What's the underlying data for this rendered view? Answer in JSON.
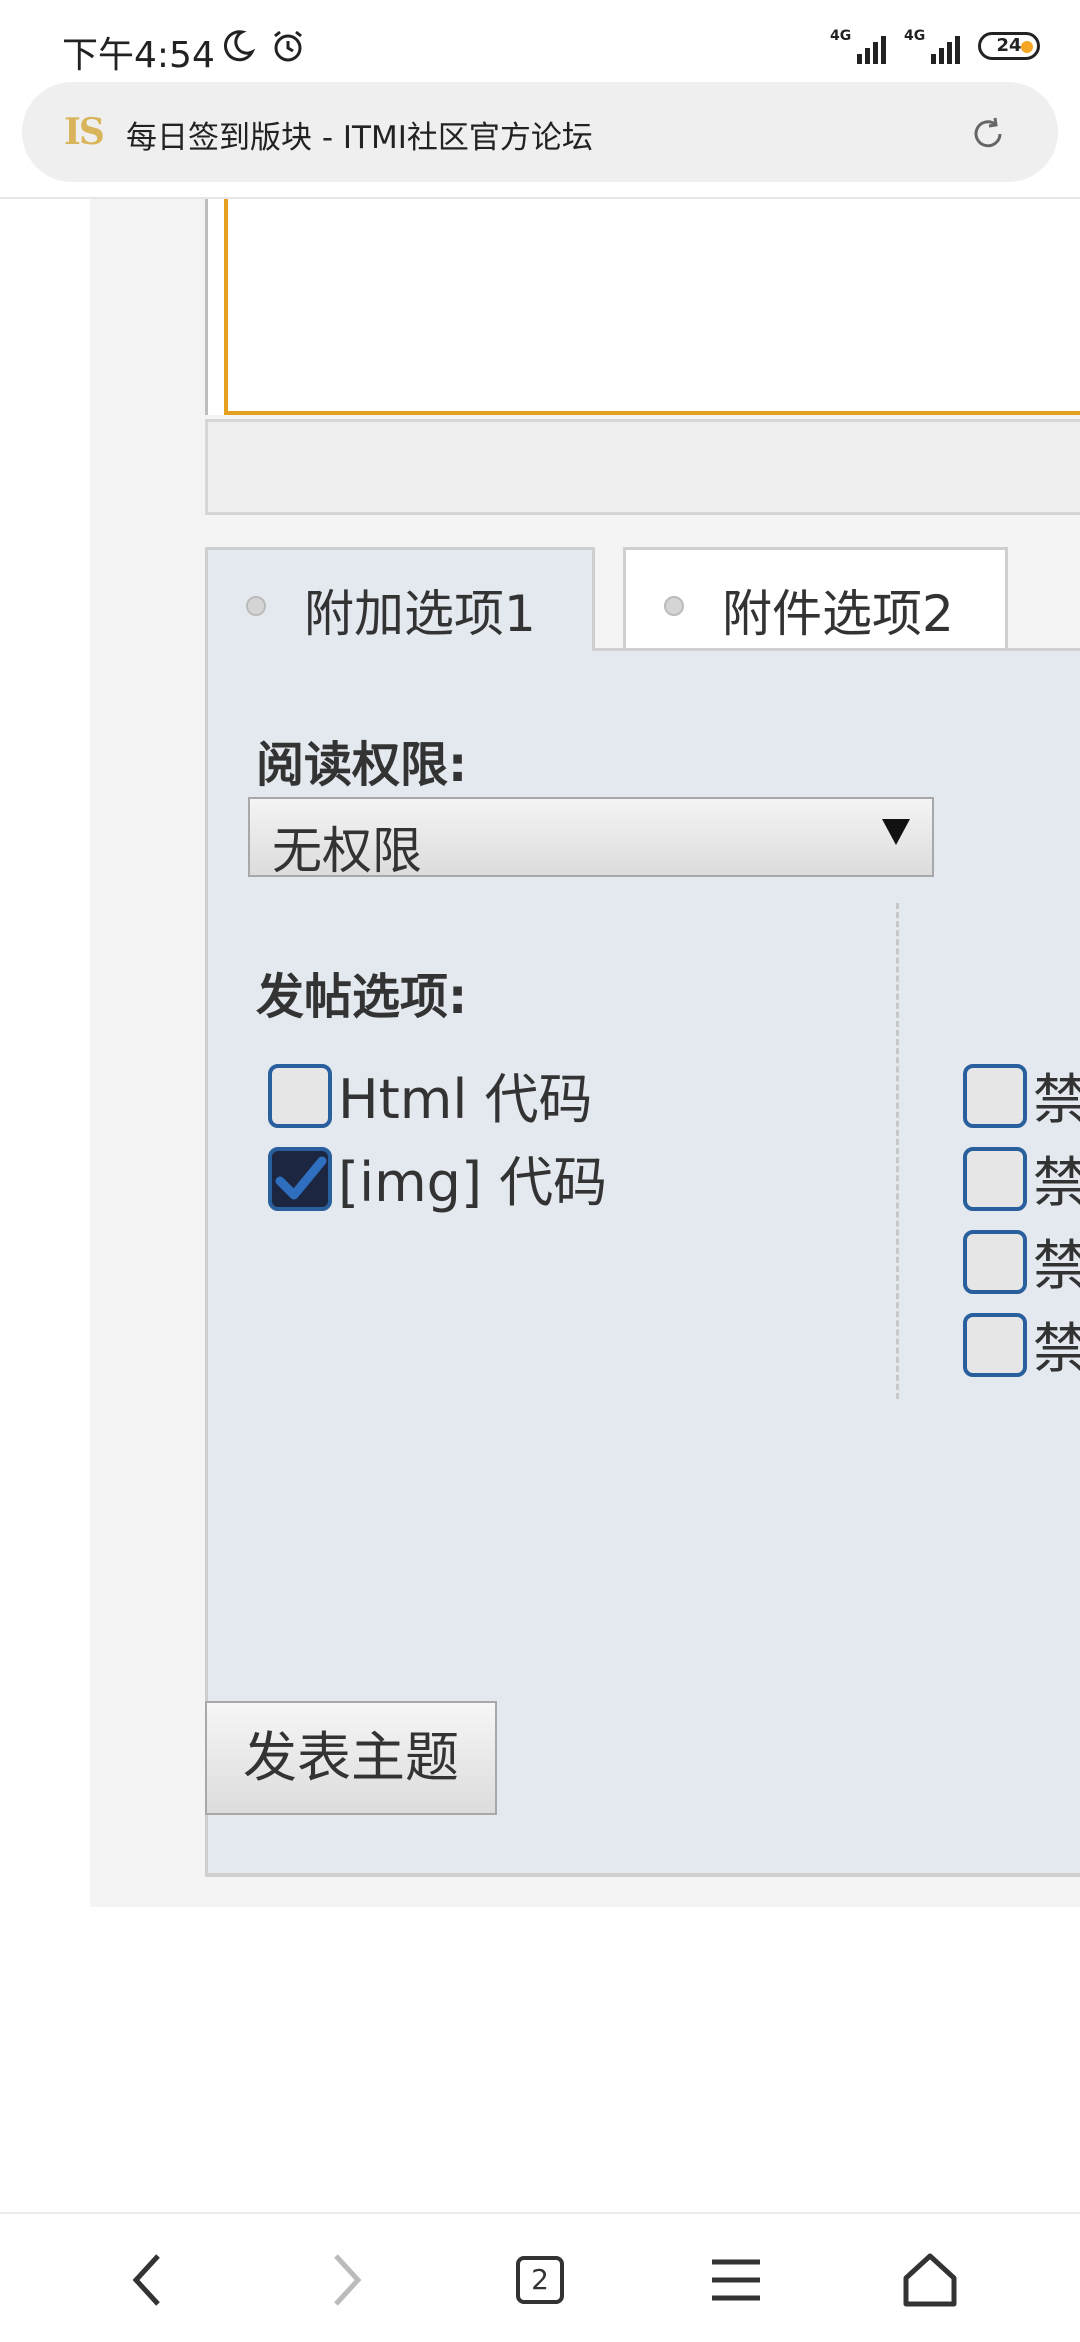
{
  "status_bar": {
    "time": "下午4:54",
    "signal1_label": "4G",
    "signal2_label": "4G",
    "battery": "24",
    "icons": [
      "moon-icon",
      "alarm-icon",
      "signal-icon",
      "signal-icon",
      "battery-icon"
    ]
  },
  "browser": {
    "favicon_text": "IS",
    "page_title": "每日签到版块 - ITMI社区官方论坛",
    "tab_count": "2"
  },
  "tabs": [
    {
      "label": "附加选项1",
      "active": true
    },
    {
      "label": "附件选项2",
      "active": false
    }
  ],
  "form": {
    "read_permission_label": "阅读权限:",
    "read_permission_value": "无权限",
    "post_options_label": "发帖选项:",
    "options_left": [
      {
        "label": "Html 代码",
        "checked": false
      },
      {
        "label": "[img] 代码",
        "checked": true
      }
    ],
    "options_right": [
      {
        "label": "禁",
        "checked": false
      },
      {
        "label": "禁",
        "checked": false
      },
      {
        "label": "禁",
        "checked": false
      },
      {
        "label": "禁",
        "checked": false
      }
    ],
    "submit_label": "发表主题"
  },
  "colors": {
    "accent_border": "#e6a020",
    "checkbox_border": "#2a5f9e",
    "panel_bg": "#e3e9ef"
  }
}
